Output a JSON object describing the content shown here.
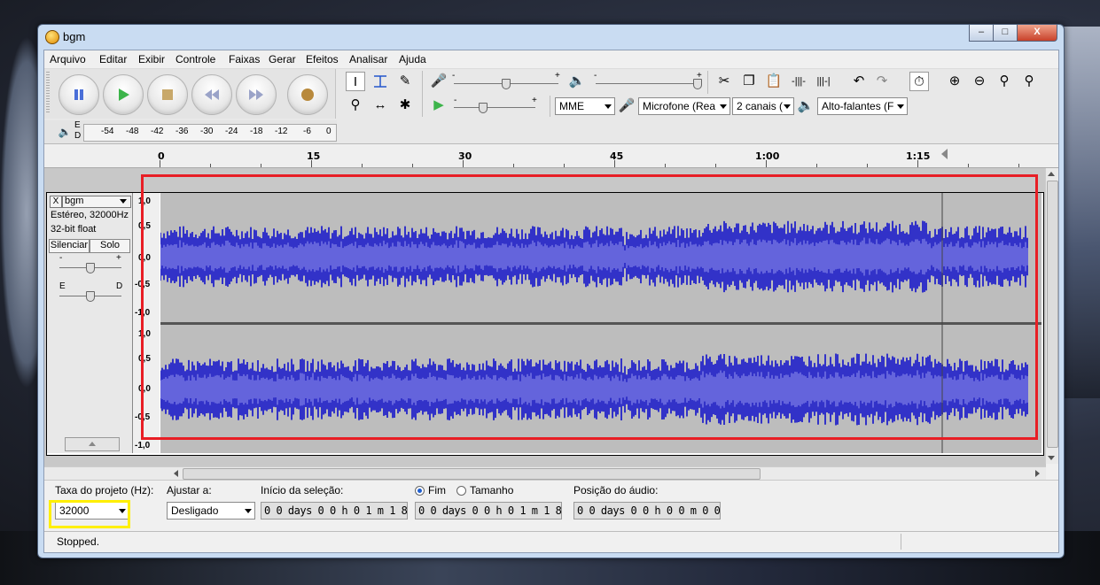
{
  "window": {
    "title": "bgm"
  },
  "menu": [
    "Arquivo",
    "Editar",
    "Exibir",
    "Controle",
    "Faixas",
    "Gerar",
    "Efeitos",
    "Analisar",
    "Ajuda"
  ],
  "toolbar": {
    "mixer_marks": {
      "minus": "-",
      "plus": "+"
    },
    "host": "MME",
    "input_device": "Microfone (Rea",
    "channels": "2 canais (",
    "output_device": "Alto-falantes (F"
  },
  "meter": {
    "e": "E",
    "d": "D",
    "ticks": [
      "-54",
      "-48",
      "-42",
      "-36",
      "-30",
      "-24",
      "-18",
      "-12",
      "-6",
      "0"
    ]
  },
  "ruler": {
    "labels": [
      "0",
      "15",
      "30",
      "45",
      "1:00",
      "1:15"
    ]
  },
  "track": {
    "name": "bgm",
    "close": "X",
    "info1": "Estéreo, 32000Hz",
    "info2": "32-bit float",
    "mute": "Silenciar",
    "solo": "Solo",
    "gain_minus": "-",
    "gain_plus": "+",
    "pan_left": "E",
    "pan_right": "D",
    "scale_top": [
      "1,0",
      "0,5",
      "0,0",
      "-0,5",
      "-1,0"
    ],
    "scale_bottom": [
      "1,0",
      "0,5",
      "0,0",
      "-0,5",
      "-1,0"
    ]
  },
  "selection": {
    "rate_label": "Taxa do projeto (Hz):",
    "rate_value": "32000",
    "snap_label": "Ajustar a:",
    "snap_value": "Desligado",
    "start_label": "Início da seleção:",
    "end_radio": "Fim",
    "length_radio": "Tamanho",
    "pos_label": "Posição do áudio:",
    "start_time": "0 0 days 0 0 h 0 1 m 1 8 s",
    "end_time": "0 0 days 0 0 h 0 1 m 1 8 s",
    "pos_time": "0 0 days 0 0 h 0 0 m 0 0 s"
  },
  "status": "Stopped.",
  "colors": {
    "wave": "#3232c8",
    "wave_rms": "#6464dc",
    "highlight_red": "#e81e25",
    "highlight_yellow": "#ffef00"
  }
}
